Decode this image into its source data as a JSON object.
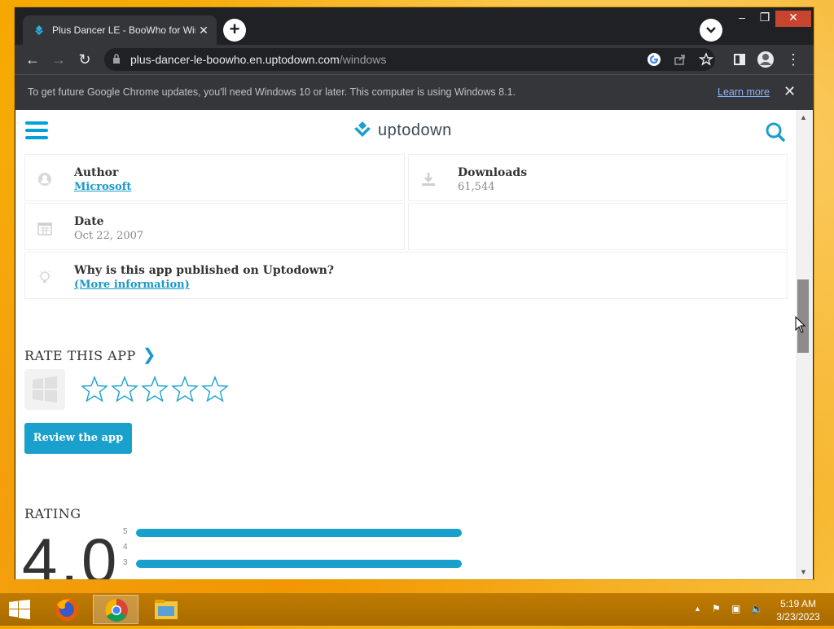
{
  "browser": {
    "tab_title": "Plus Dancer LE - BooWho for Wir",
    "url_host": "plus-dancer-le-boowho.en.uptodown.com",
    "url_path": "/windows",
    "infobar_message": "To get future Google Chrome updates, you'll need Windows 10 or later. This computer is using Windows 8.1.",
    "infobar_link": "Learn more"
  },
  "site": {
    "logo_text": "uptodown",
    "accent": "#1aa0cc"
  },
  "info": {
    "author_label": "Author",
    "author_value": "Microsoft",
    "downloads_label": "Downloads",
    "downloads_value": "61,544",
    "date_label": "Date",
    "date_value": "Oct 22, 2007",
    "why_label": "Why is this app published on Uptodown?",
    "why_link": "(More information)"
  },
  "rate": {
    "title": "RATE THIS APP",
    "review_button": "Review the app",
    "star_count": 5
  },
  "rating": {
    "title": "RATING",
    "score": "4.0",
    "bars": [
      {
        "label": "5",
        "fraction": 1.0
      },
      {
        "label": "4",
        "fraction": 0.0
      },
      {
        "label": "3",
        "fraction": 1.0
      }
    ]
  },
  "taskbar": {
    "time": "5:19 AM",
    "date": "3/23/2023"
  }
}
